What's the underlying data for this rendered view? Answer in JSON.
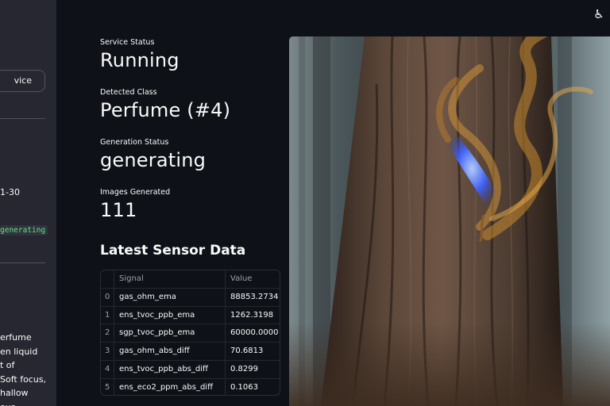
{
  "sidebar": {
    "button_label": "vice",
    "range_text": "1-30",
    "status_code": "generating",
    "description_lines": [
      "erfume",
      "en liquid",
      "t of",
      "Soft focus,",
      "hallow",
      "ous"
    ]
  },
  "header": {
    "icon": "accessibility-icon",
    "icon_glyph": "♿"
  },
  "metrics": [
    {
      "label": "Service Status",
      "value": "Running"
    },
    {
      "label": "Detected Class",
      "value": "Perfume (#4)"
    },
    {
      "label": "Generation Status",
      "value": "generating"
    },
    {
      "label": "Images Generated",
      "value": "111"
    }
  ],
  "sensor": {
    "title": "Latest Sensor Data",
    "columns": [
      "",
      "Signal",
      "Value"
    ],
    "rows": [
      {
        "index": "0",
        "signal": "gas_ohm_ema",
        "value": "88853.2734"
      },
      {
        "index": "1",
        "signal": "ens_tvoc_ppb_ema",
        "value": "1262.3198"
      },
      {
        "index": "2",
        "signal": "sgp_tvoc_ppb_ema",
        "value": "60000.0000"
      },
      {
        "index": "3",
        "signal": "gas_ohm_abs_diff",
        "value": "70.6813"
      },
      {
        "index": "4",
        "signal": "ens_tvoc_ppb_abs_diff",
        "value": "0.8299"
      },
      {
        "index": "5",
        "signal": "ens_eco2_ppm_abs_diff",
        "value": "0.1063"
      }
    ]
  },
  "image": {
    "subject": "tree trunk with blue flame and orange smoke"
  }
}
